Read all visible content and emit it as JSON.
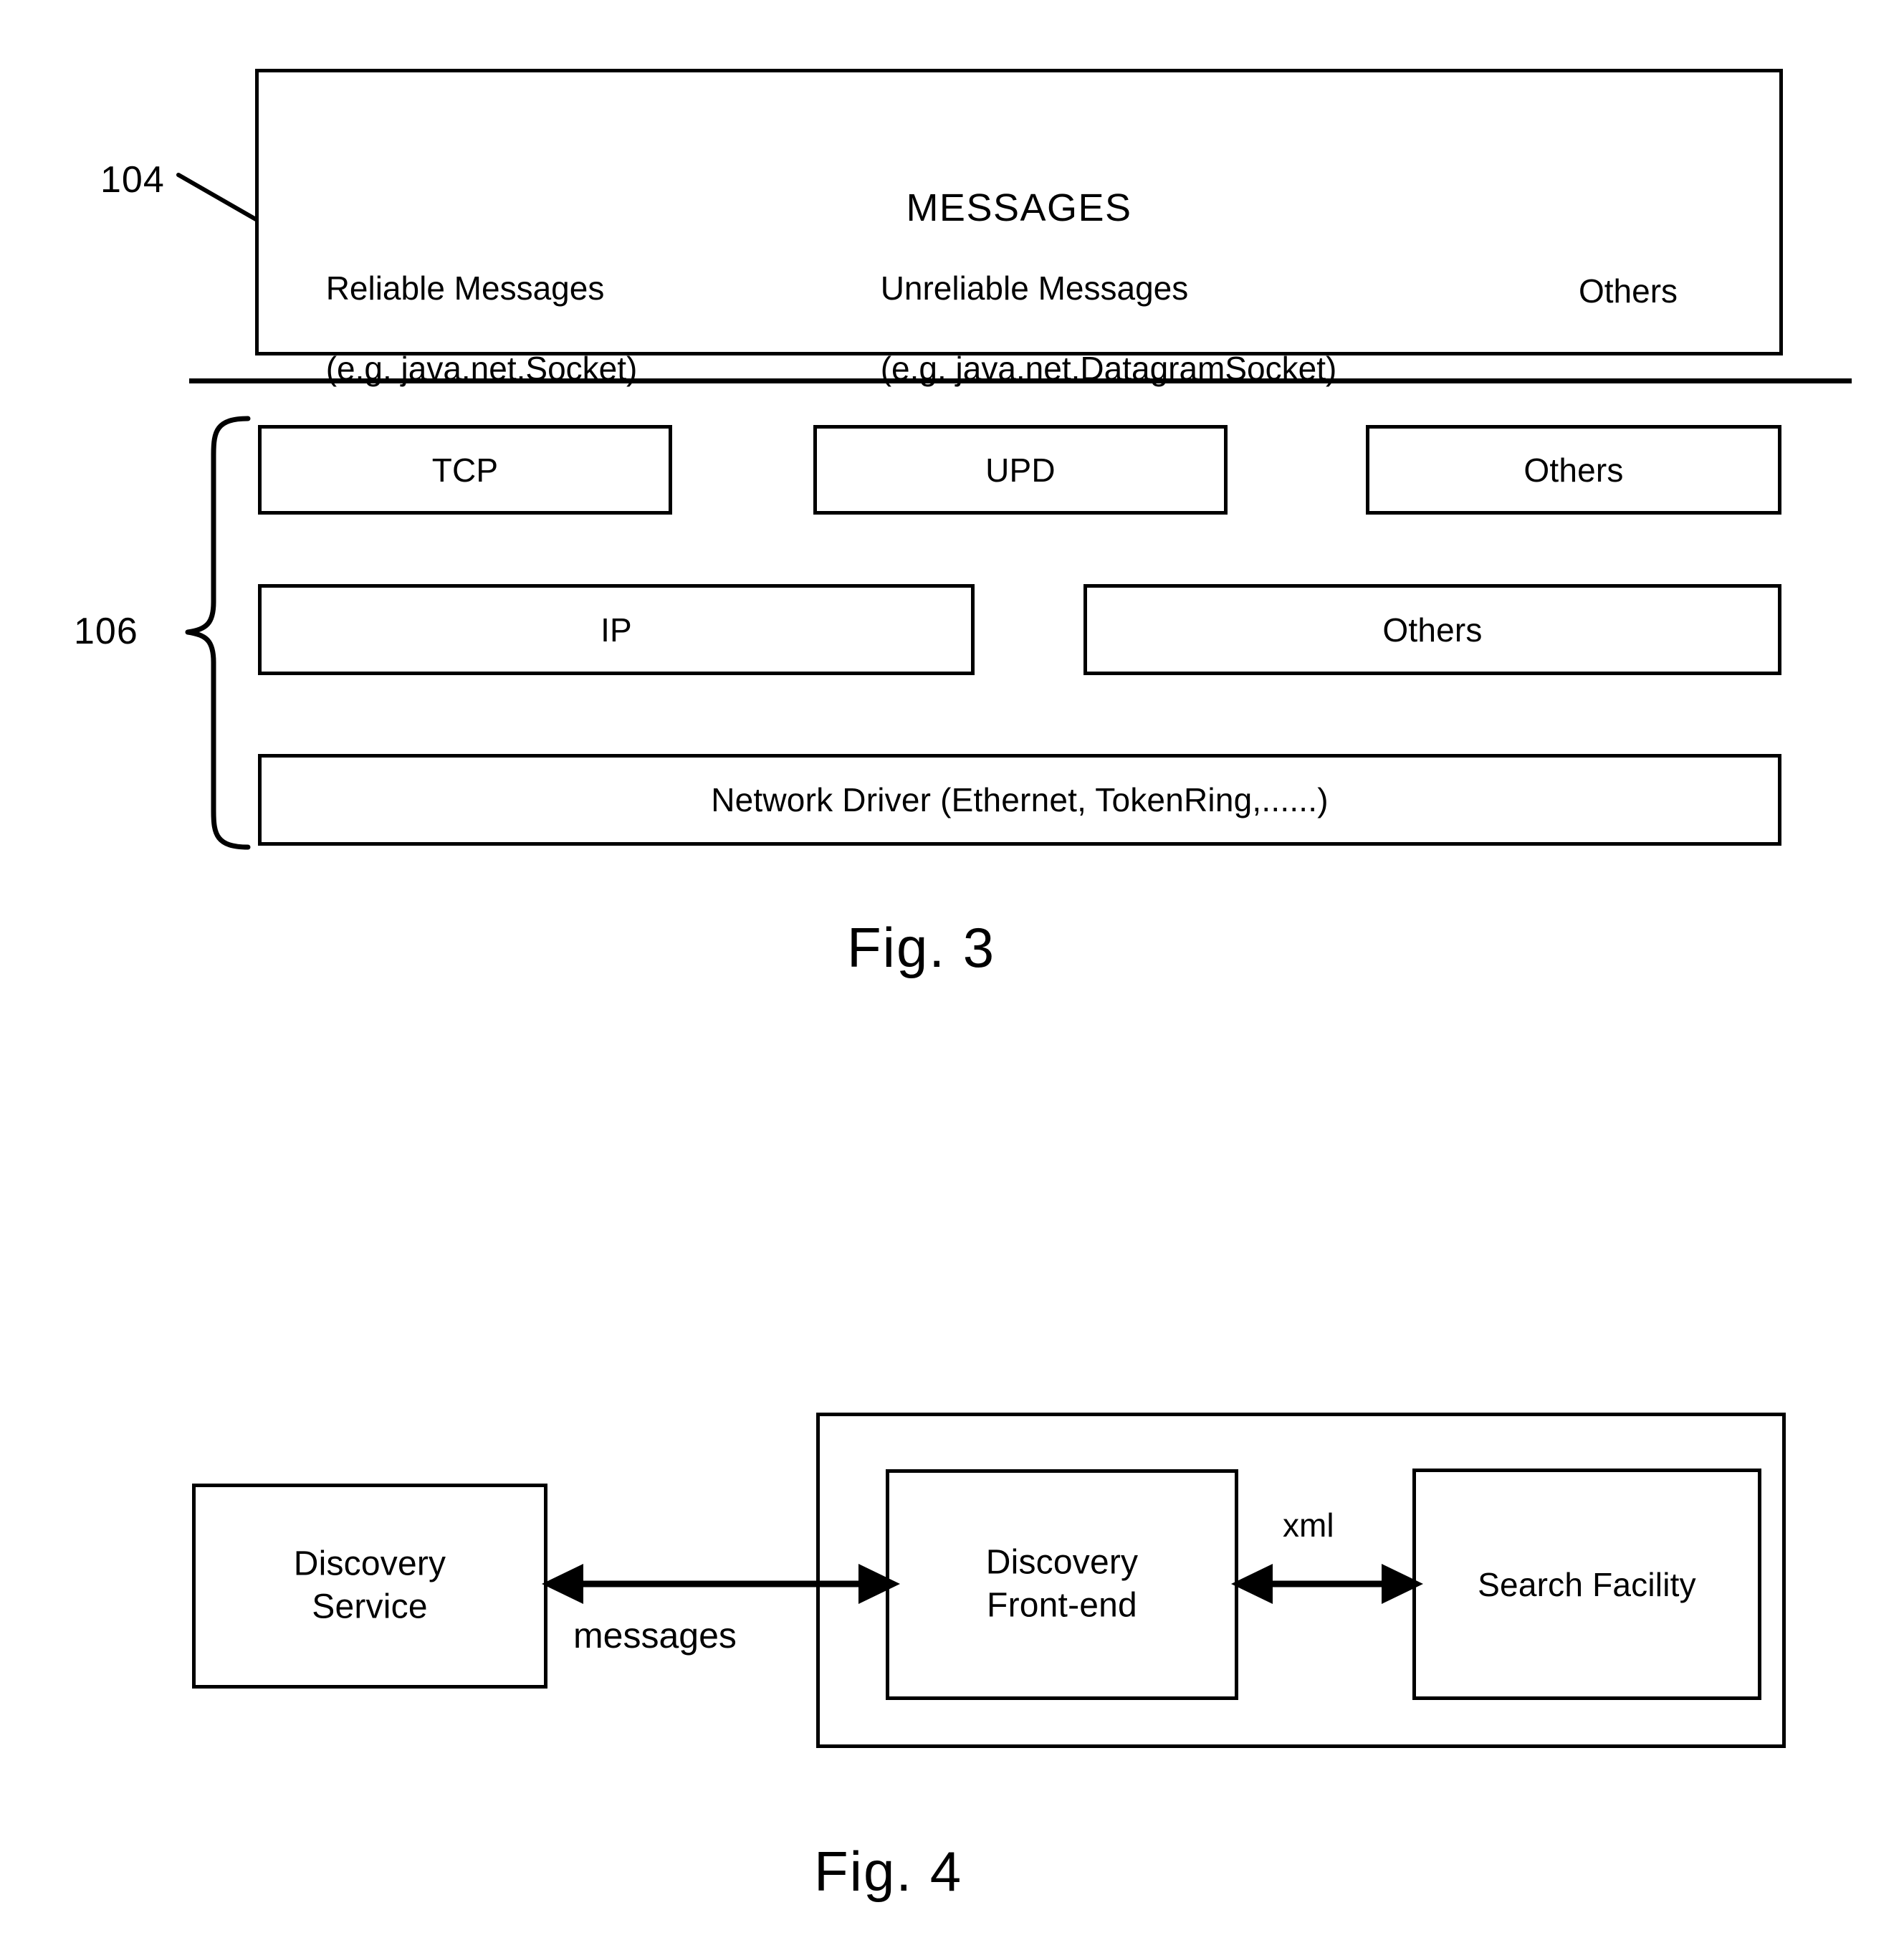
{
  "figure3": {
    "reference_numbers": {
      "messages_layer": "104",
      "transport_layer": "106"
    },
    "messages_box": {
      "title": "MESSAGES",
      "columns": [
        {
          "line1": "Reliable Messages",
          "line2": "(e.g. java.net.Socket)"
        },
        {
          "line1": "Unreliable Messages",
          "line2": "(e.g. java.net.DatagramSocket)"
        },
        {
          "line1": "Others",
          "line2": ""
        }
      ]
    },
    "protocol_row": [
      {
        "label": "TCP"
      },
      {
        "label": "UPD"
      },
      {
        "label": "Others"
      }
    ],
    "network_row": [
      {
        "label": "IP"
      },
      {
        "label": "Others"
      }
    ],
    "driver_row": {
      "label": "Network Driver (Ethernet, TokenRing,......)"
    },
    "caption": "Fig. 3"
  },
  "figure4": {
    "nodes": {
      "discovery_service": {
        "line1": "Discovery",
        "line2": "Service"
      },
      "discovery_frontend": {
        "line1": "Discovery",
        "line2": "Front-end"
      },
      "search_facility": {
        "line1": "Search Facility",
        "line2": ""
      }
    },
    "edges": {
      "service_to_frontend": "messages",
      "frontend_to_search": "xml"
    },
    "caption": "Fig. 4"
  },
  "colors": {
    "ink": "#000000",
    "paper": "#ffffff"
  }
}
